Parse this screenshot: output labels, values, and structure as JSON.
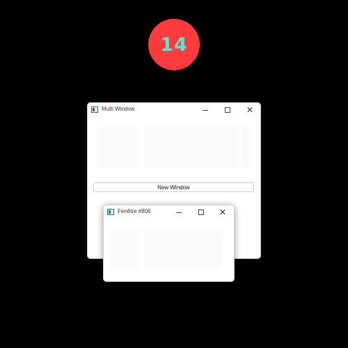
{
  "badge": {
    "number": "14",
    "color": "#ff3b3b",
    "text_color": "#5fe3d0"
  },
  "main_window": {
    "title": "Multi Window",
    "icon": "window-app-icon",
    "controls": [
      "minimize",
      "maximize",
      "close"
    ],
    "new_window_button": "New Window"
  },
  "child_window": {
    "title": "Fenêtre #806",
    "icon": "window-app-icon",
    "controls": [
      "minimize",
      "maximize",
      "close"
    ]
  }
}
